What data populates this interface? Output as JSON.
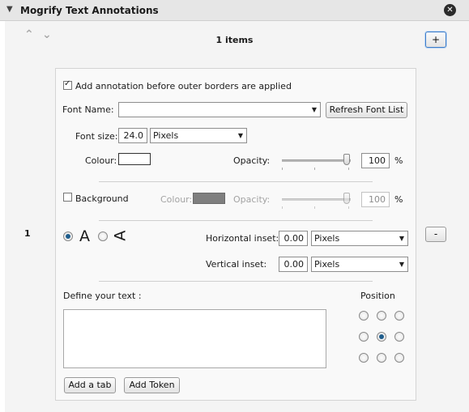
{
  "header": {
    "title": "Mogrify Text Annotations",
    "collapse_icon": "triangle-down-icon",
    "close_icon": "close-circle-icon"
  },
  "nav": {
    "up_icon": "chevron-up-icon",
    "down_icon": "chevron-down-icon",
    "count_label": "1 items",
    "add_label": "+",
    "remove_label": "-"
  },
  "item": {
    "index": "1",
    "add_before_borders": {
      "label": "Add annotation before outer borders are applied",
      "checked": true
    },
    "font_name": {
      "label": "Font Name:",
      "value": "",
      "refresh_label": "Refresh Font List"
    },
    "font_size": {
      "label": "Font size:",
      "value": "24.0",
      "unit": "Pixels"
    },
    "colour": {
      "label": "Colour:",
      "value": "#ffffff"
    },
    "opacity": {
      "label": "Opacity:",
      "value": "100",
      "unit": "%"
    },
    "background": {
      "label": "Background",
      "checked": false,
      "colour_label": "Colour:",
      "colour_value": "#7f7f7f",
      "opacity_label": "Opacity:",
      "opacity_value": "100",
      "unit": "%"
    },
    "orientation": {
      "normal_glyph": "A",
      "rotated_glyph": "A",
      "selected": "normal"
    },
    "horizontal_inset": {
      "label": "Horizontal inset:",
      "value": "0.00",
      "unit": "Pixels"
    },
    "vertical_inset": {
      "label": "Vertical inset:",
      "value": "0.00",
      "unit": "Pixels"
    },
    "define_text": {
      "label": "Define your text :",
      "value": ""
    },
    "position": {
      "label": "Position",
      "selected": "center"
    },
    "buttons": {
      "add_tab": "Add a tab",
      "add_token": "Add Token"
    }
  }
}
